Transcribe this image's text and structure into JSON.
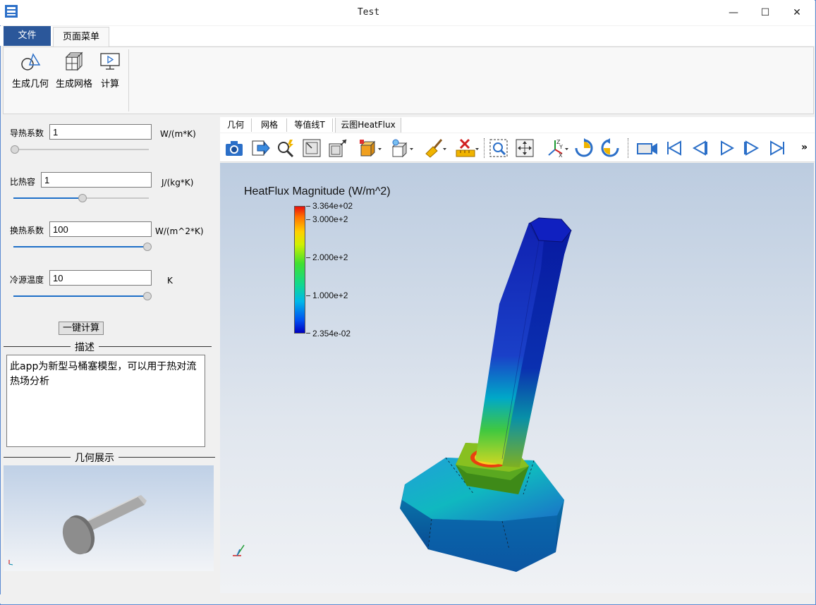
{
  "window": {
    "title": "Test",
    "minimize": "—",
    "maximize": "☐",
    "close": "✕"
  },
  "ribbon": {
    "tabs": [
      "文件",
      "页面菜单"
    ],
    "buttons": [
      {
        "label": "生成几何",
        "icon": "geometry-icon"
      },
      {
        "label": "生成网格",
        "icon": "mesh-icon"
      },
      {
        "label": "计算",
        "icon": "compute-icon"
      }
    ]
  },
  "params": {
    "conductivity": {
      "label": "导热系数",
      "value": "1",
      "unit": "W/(m*K)",
      "slider_fraction": 0.0
    },
    "specific_heat": {
      "label": "比热容",
      "value": "1",
      "unit": "J/(kg*K)",
      "slider_fraction": 0.5
    },
    "heat_transfer": {
      "label": "换热系数",
      "value": "100",
      "unit": "W/(m^2*K)",
      "slider_fraction": 1.0
    },
    "cold_temp": {
      "label": "冷源温度",
      "value": "10",
      "unit": "K",
      "slider_fraction": 1.0
    }
  },
  "calc_button": "一键计算",
  "description": {
    "title": "描述",
    "text": "此app为新型马桶塞模型，可以用于热对流热场分析"
  },
  "geometry_preview": {
    "title": "几何展示"
  },
  "viewer": {
    "tabs": [
      "几何",
      "网格",
      "等值线T",
      "云图HeatFlux"
    ],
    "toolbar_icons": [
      "camera-icon",
      "export-icon",
      "zoom-magic-icon",
      "fit-icon",
      "resize-icon",
      "box-display-icon",
      "light-display-icon",
      "clear-icon",
      "ruler-icon",
      "zoom-region-icon",
      "pan-icon",
      "axes-icon",
      "rotate-cw-icon",
      "rotate-ccw-icon",
      "video-icon",
      "first-frame-icon",
      "prev-frame-icon",
      "play-icon",
      "next-frame-icon",
      "last-frame-icon",
      "more-icon"
    ],
    "more": "»"
  },
  "legend": {
    "title": "HeatFlux Magnitude (W/m^2)",
    "max": "3.364e+02",
    "ticks": [
      "3.000e+2",
      "2.000e+2",
      "1.000e+2"
    ],
    "min": "2.354e-02"
  },
  "colors": {
    "accent": "#2b579a",
    "slider": "#1e6fc8"
  }
}
